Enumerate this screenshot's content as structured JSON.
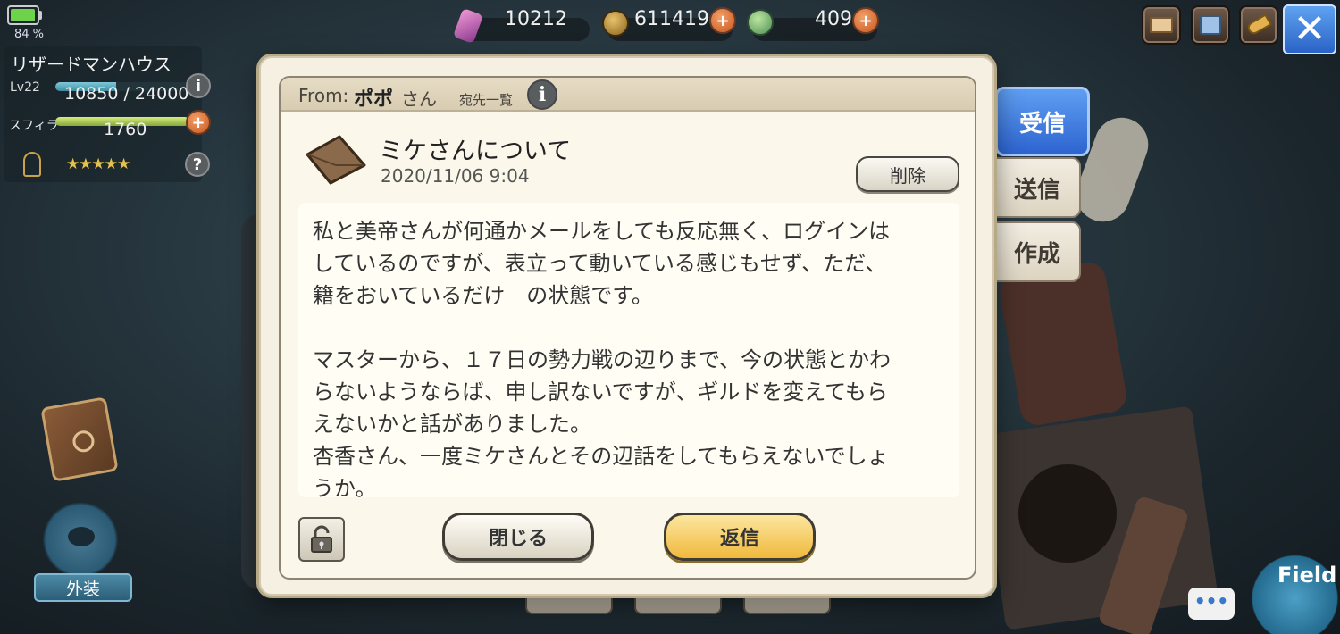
{
  "status": {
    "battery_percent": "84 %",
    "battery_level": 0.84
  },
  "player": {
    "house_name": "リザードマンハウス",
    "level_label": "Lv22",
    "xp_text": "10850 / 24000",
    "xp_fraction": 0.45,
    "sphira_label": "スフィラ",
    "sphira_value": "1760",
    "sphira_fraction": 1.0,
    "stars": "★★★★★"
  },
  "currencies": {
    "gems": "10212",
    "coins": "611419",
    "potions": "409"
  },
  "tabs": {
    "inbox": "受信",
    "sent": "送信",
    "compose": "作成"
  },
  "side": {
    "costume_label": "外装",
    "field_label": "Field",
    "chat_dots": "•••"
  },
  "mail": {
    "from_label": "From:",
    "from_name": "ポポ",
    "from_suffix": "さん",
    "recipients_label": "宛先一覧",
    "subject": "ミケさんについて",
    "date": "2020/11/06 9:04",
    "delete_label": "削除",
    "body": "私と美帝さんが何通かメールをしても反応無く、ログインは\nしているのですが、表立って動いている感じもせず、ただ、\n籍をおいているだけ　の状態です。\n\nマスターから、１７日の勢力戦の辺りまで、今の状態とかわ\nらないようならば、申し訳ないですが、ギルドを変えてもら\nえないかと話がありました。\n杏香さん、一度ミケさんとその辺話をしてもらえないでしょ\nうか。",
    "close_label": "閉じる",
    "reply_label": "返信"
  },
  "colors": {
    "accent_blue": "#2d64d0",
    "reply_gold": "#f0b93c",
    "plus_orange": "#c8561f"
  }
}
